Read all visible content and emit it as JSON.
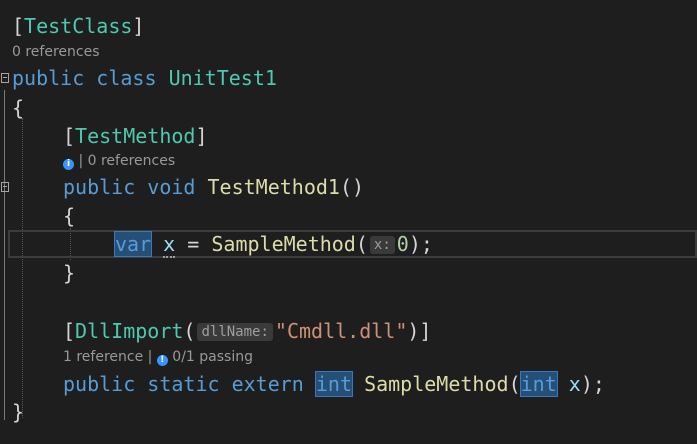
{
  "code": {
    "attr_testclass": {
      "open": "[",
      "name": "TestClass",
      "close": "]"
    },
    "lens_class": "0 references",
    "class_decl": {
      "kw1": "public",
      "kw2": "class",
      "name": "UnitTest1"
    },
    "brace_open": "{",
    "attr_testmethod": {
      "open": "[",
      "name": "TestMethod",
      "close": "]"
    },
    "lens_method": {
      "icon": "info-icon",
      "text": "| 0 references"
    },
    "method_decl": {
      "kw1": "public",
      "kw2": "void",
      "name": "TestMethod1",
      "parens": "()"
    },
    "method_brace_open": "{",
    "stmt": {
      "kw": "var",
      "var": "x",
      "assign": "=",
      "call": "SampleMethod",
      "paren_open": "(",
      "hint": "x:",
      "arg": "0",
      "end": ");"
    },
    "method_brace_close": "}",
    "attr_dllimport": {
      "open": "[",
      "name": "DllImport",
      "paren_open": "(",
      "hint": "dllName:",
      "value": "\"Cmdll.dll\"",
      "close": ")]"
    },
    "lens_extern": {
      "text1": "1 reference |",
      "icon": "status-icon",
      "text2": "0/1 passing"
    },
    "extern_decl": {
      "kw1": "public",
      "kw2": "static",
      "kw3": "extern",
      "ret": "int",
      "name": "SampleMethod",
      "paren_open": "(",
      "ptype": "int",
      "pname": "x",
      "end": ");"
    },
    "brace_close": "}"
  }
}
